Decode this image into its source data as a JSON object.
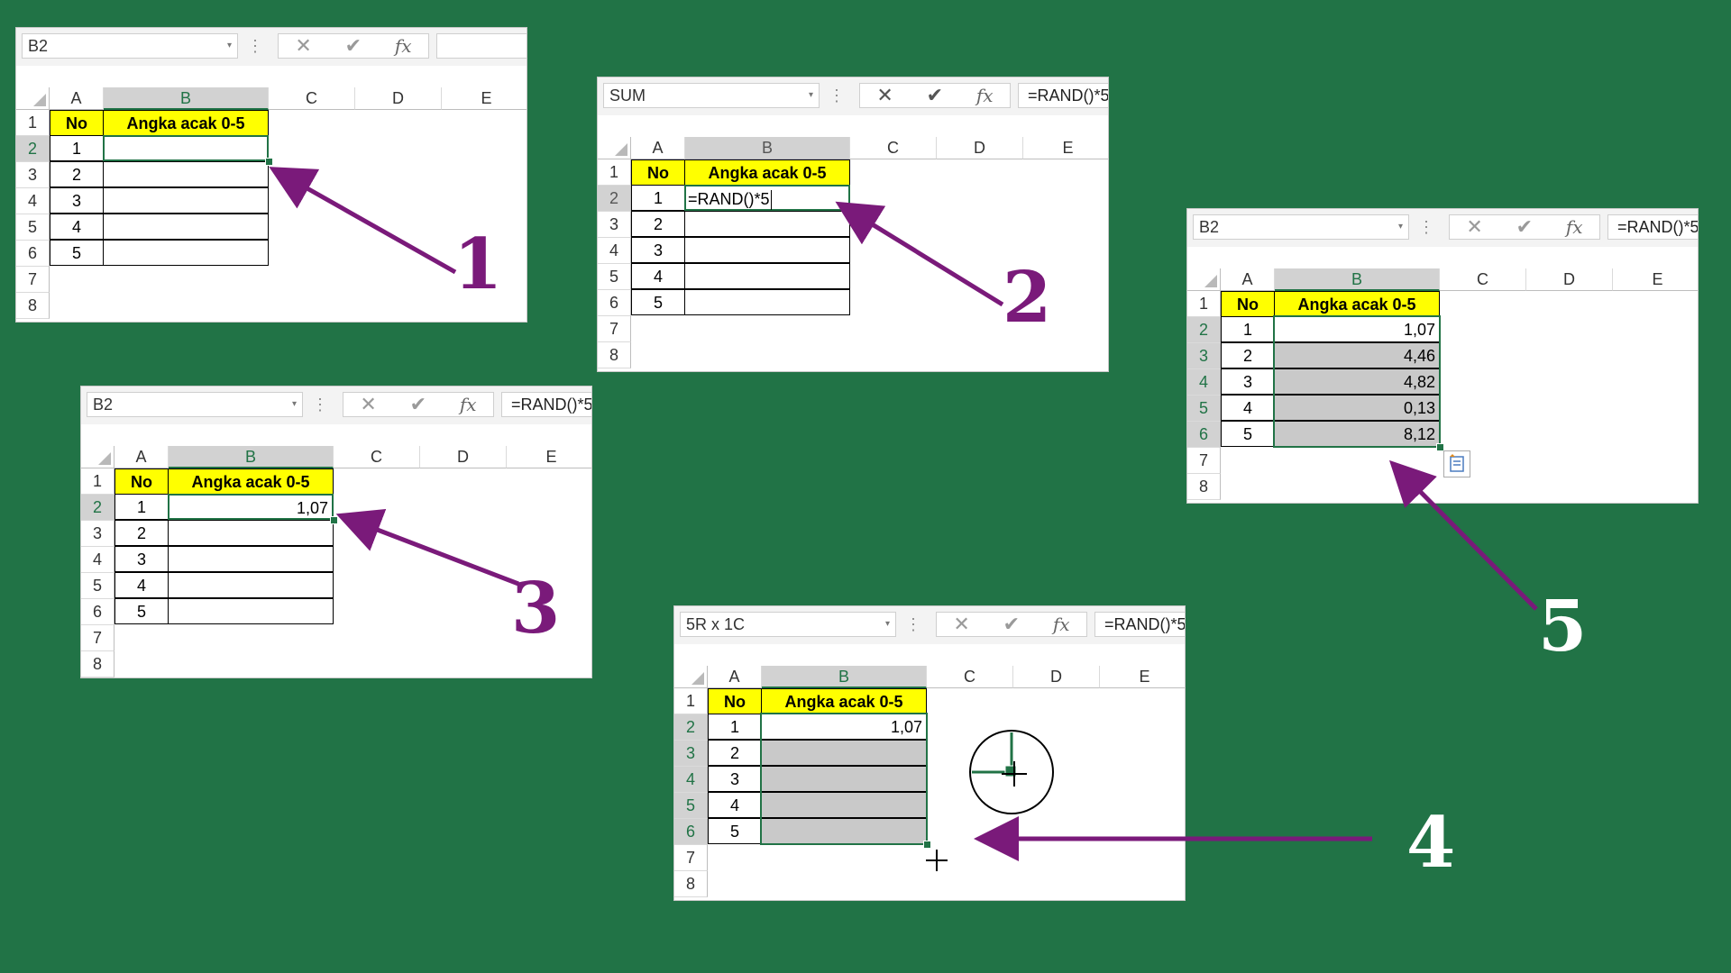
{
  "colors": {
    "background": "#217346",
    "accent": "#217346",
    "arrow": "#7a1a7a",
    "header_fill": "#ffff00"
  },
  "columns": [
    "A",
    "B",
    "C",
    "D",
    "E"
  ],
  "rows": [
    "1",
    "2",
    "3",
    "4",
    "5",
    "6",
    "7",
    "8"
  ],
  "header": {
    "no": "No",
    "angka": "Angka acak 0-5"
  },
  "numbers": [
    "1",
    "2",
    "3",
    "4",
    "5"
  ],
  "icons": {
    "cancel": "✕",
    "enter": "✔",
    "fx": "fx",
    "dropdown": "▾",
    "dots": "⋮"
  },
  "steps": {
    "s1": {
      "label": "1",
      "namebox": "B2",
      "formula": ""
    },
    "s2": {
      "label": "2",
      "namebox": "SUM",
      "formula": "=RAND()*5",
      "cell_text": "=RAND()*5"
    },
    "s3": {
      "label": "3",
      "namebox": "B2",
      "formula": "=RAND()*5",
      "cell_value": "1,07"
    },
    "s4": {
      "label": "4",
      "namebox": "5R x 1C",
      "formula": "=RAND()*5",
      "cell_value": "1,07"
    },
    "s5": {
      "label": "5",
      "namebox": "B2",
      "formula": "=RAND()*5",
      "values": [
        "1,07",
        "4,46",
        "4,82",
        "0,13",
        "8,12"
      ]
    }
  }
}
